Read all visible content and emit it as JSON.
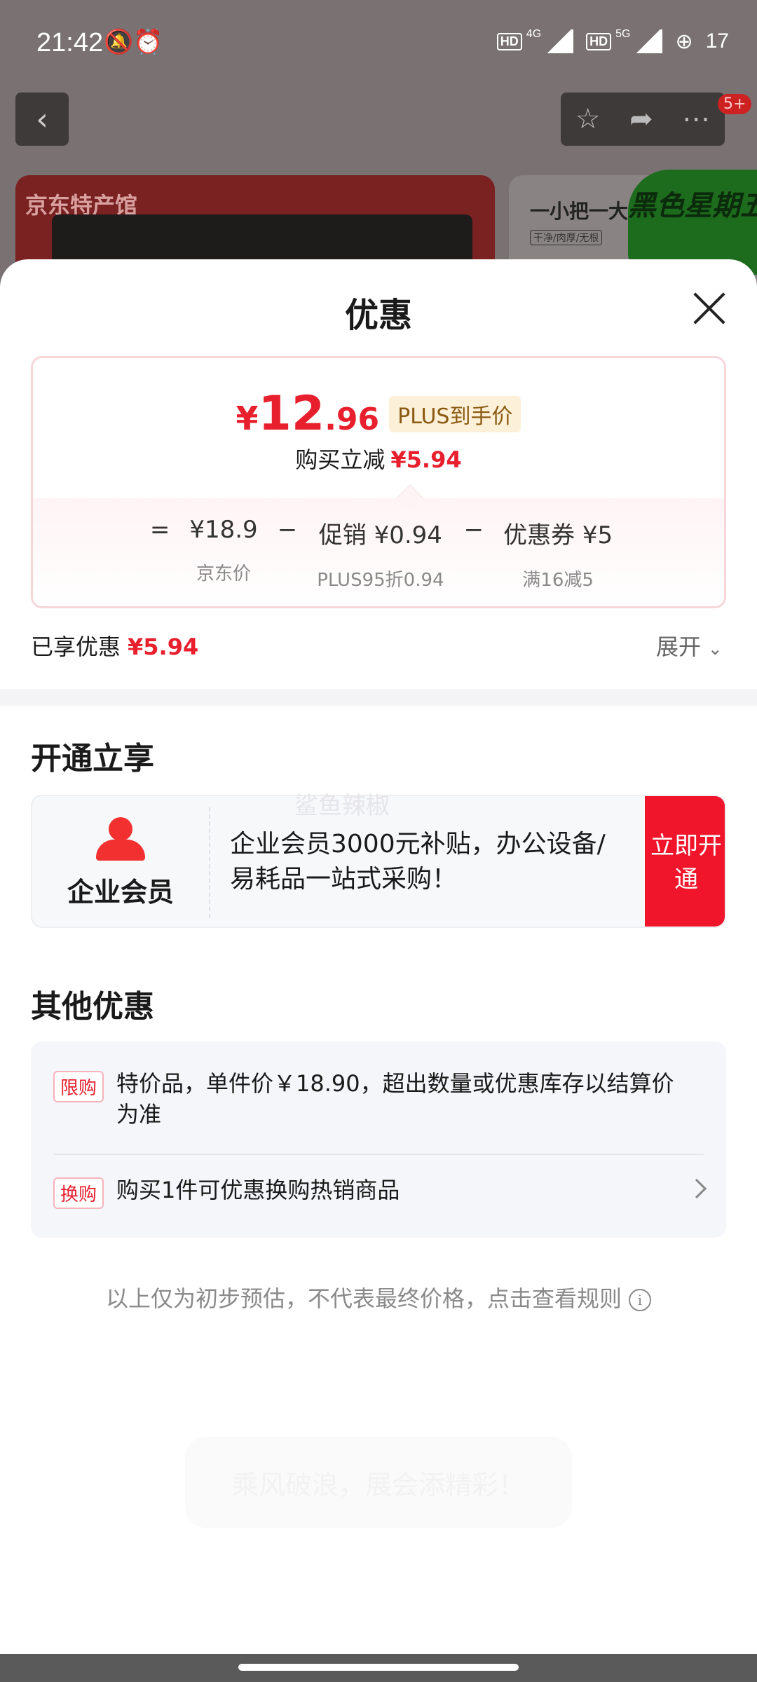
{
  "status_bar": {
    "time": "21:42",
    "left_icons": "🔕⏰",
    "hd1": "HD",
    "net1": "4G",
    "hd2": "HD",
    "net2": "5G",
    "battery": "17"
  },
  "background": {
    "badge": "5+",
    "card1_brand": "京东特产馆",
    "card2_text": "一小把一大",
    "card2_sub": "干净/肉厚/无根",
    "card2_promo": "黑色星期五"
  },
  "sheet": {
    "title": "优惠"
  },
  "price_card": {
    "currency": "¥",
    "price_int": "12",
    "price_dec": ".96",
    "plus_tag": "PLUS到手价",
    "save_label": "购买立减",
    "save_amount": "¥5.94",
    "formula": {
      "eq": "=",
      "jd_price": "¥18.9",
      "jd_price_label": "京东价",
      "minus1": "−",
      "promo": "促销 ¥0.94",
      "promo_label": "PLUS95折0.94",
      "minus2": "−",
      "coupon": "优惠券 ¥5",
      "coupon_label": "满16减5"
    }
  },
  "enjoyed": {
    "label": "已享优惠",
    "amount": "¥5.94",
    "expand": "展开"
  },
  "open_section": {
    "title": "开通立享",
    "member_name": "企业会员",
    "member_desc": "企业会员3000元补贴，办公设备/易耗品一站式采购！",
    "button": "立即开通",
    "watermark": "鲨鱼辣椒"
  },
  "other_section": {
    "title": "其他优惠",
    "items": [
      {
        "tag": "限购",
        "text": "特价品，单件价￥18.90，超出数量或优惠库存以结算价为准"
      },
      {
        "tag": "换购",
        "text": "购买1件可优惠换购热销商品"
      }
    ]
  },
  "disclaimer": "以上仅为初步预估，不代表最终价格，点击查看规则",
  "ghost_toast": "乘风破浪，展会添精彩！"
}
